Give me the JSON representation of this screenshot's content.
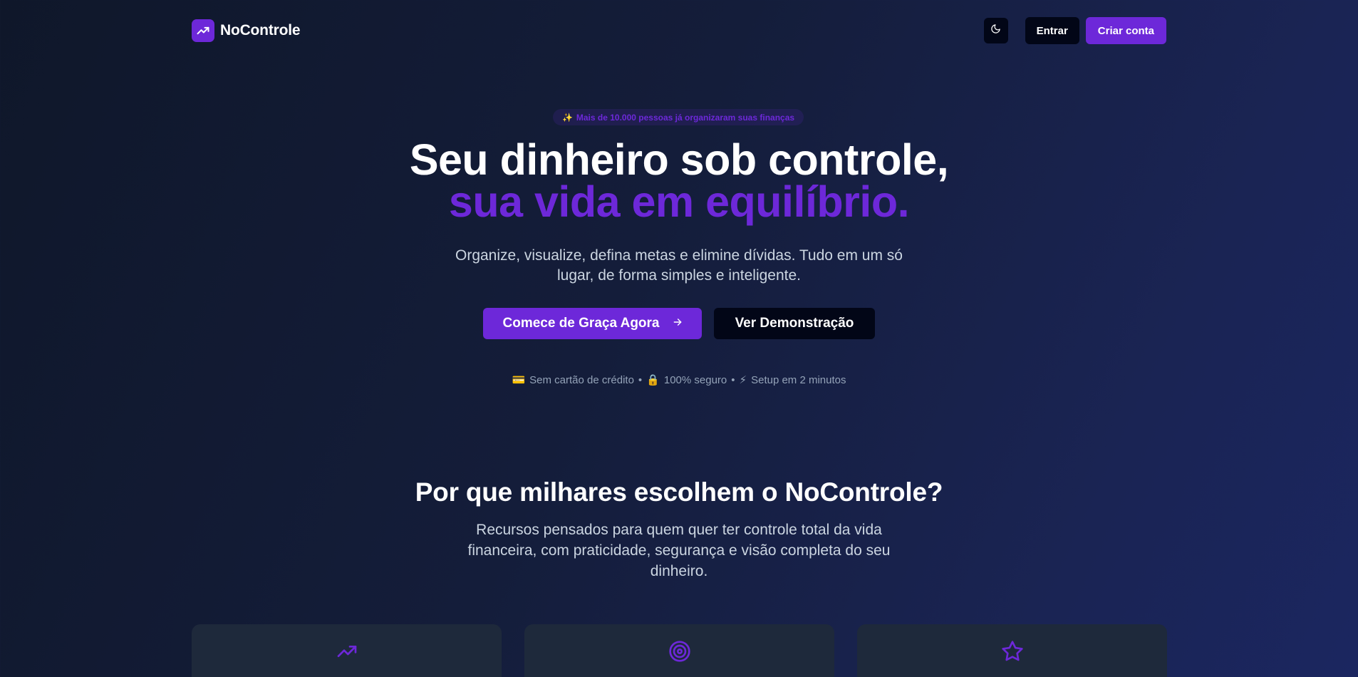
{
  "header": {
    "brand_name": "NoControle",
    "brand_icon": "trending-up-icon",
    "theme_icon": "moon-icon",
    "login_label": "Entrar",
    "signup_label": "Criar conta"
  },
  "hero": {
    "badge_emoji": "✨",
    "badge_text": "Mais de 10.000 pessoas já organizaram suas finanças",
    "title_line1": "Seu dinheiro sob controle,",
    "title_line2": "sua vida em equilíbrio.",
    "subtitle": "Organize, visualize, defina metas e elimine dívidas. Tudo em um só lugar, de forma simples e inteligente.",
    "cta_primary": "Comece de Graça Agora",
    "cta_primary_icon": "arrow-right-icon",
    "cta_secondary": "Ver Demonstração",
    "trust": [
      {
        "emoji": "💳",
        "text": "Sem cartão de crédito"
      },
      {
        "emoji": "🔒",
        "text": "100% seguro"
      },
      {
        "emoji": "⚡",
        "text": "Setup em 2 minutos"
      }
    ],
    "separator": "•"
  },
  "features": {
    "title": "Por que milhares escolhem o NoControle?",
    "subtitle": "Recursos pensados para quem quer ter controle total da vida financeira, com praticidade, segurança e visão completa do seu dinheiro.",
    "cards": [
      {
        "icon": "trending-up-icon"
      },
      {
        "icon": "target-icon"
      },
      {
        "icon": "star-icon"
      }
    ]
  },
  "colors": {
    "accent": "#6d28d9",
    "button_dark": "#020617",
    "card_bg": "#1e293b",
    "muted_text": "#94a3b8"
  }
}
